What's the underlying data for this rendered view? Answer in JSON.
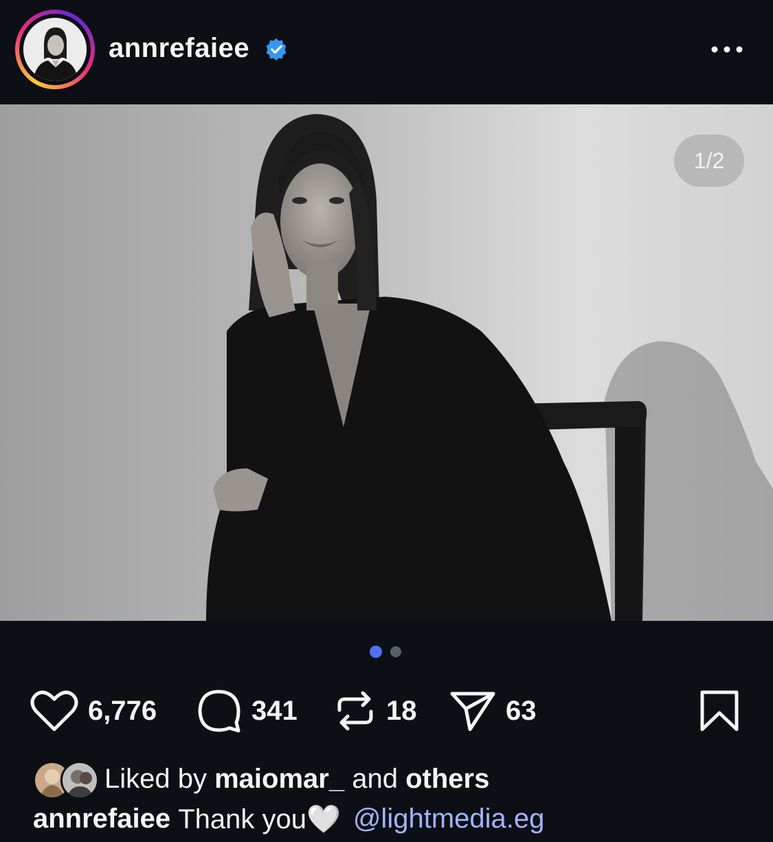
{
  "post": {
    "username": "annrefaiee",
    "verified": true,
    "slide_counter": "1/2",
    "slides_total": 2,
    "active_slide": 1
  },
  "icons": {
    "verified": "verified-badge-icon",
    "more": "more-options-icon",
    "like": "heart-icon",
    "comment": "comment-icon",
    "repost": "repost-icon",
    "share": "send-icon",
    "save": "bookmark-icon"
  },
  "actions": {
    "likes": "6,776",
    "comments": "341",
    "reposts": "18",
    "shares": "63"
  },
  "liked_by": {
    "prefix": "Liked by",
    "user": "maiomar_",
    "conjunction": "and",
    "others": "others"
  },
  "caption": {
    "username": "annrefaiee",
    "text": "Thank you🤍",
    "mention": "@lightmedia.eg"
  },
  "colors": {
    "background": "#0c0f14",
    "verified_blue": "#3897f0",
    "active_dot": "#4f6ef7",
    "inactive_dot": "#5a5f66",
    "mention": "#a3b3ff"
  }
}
